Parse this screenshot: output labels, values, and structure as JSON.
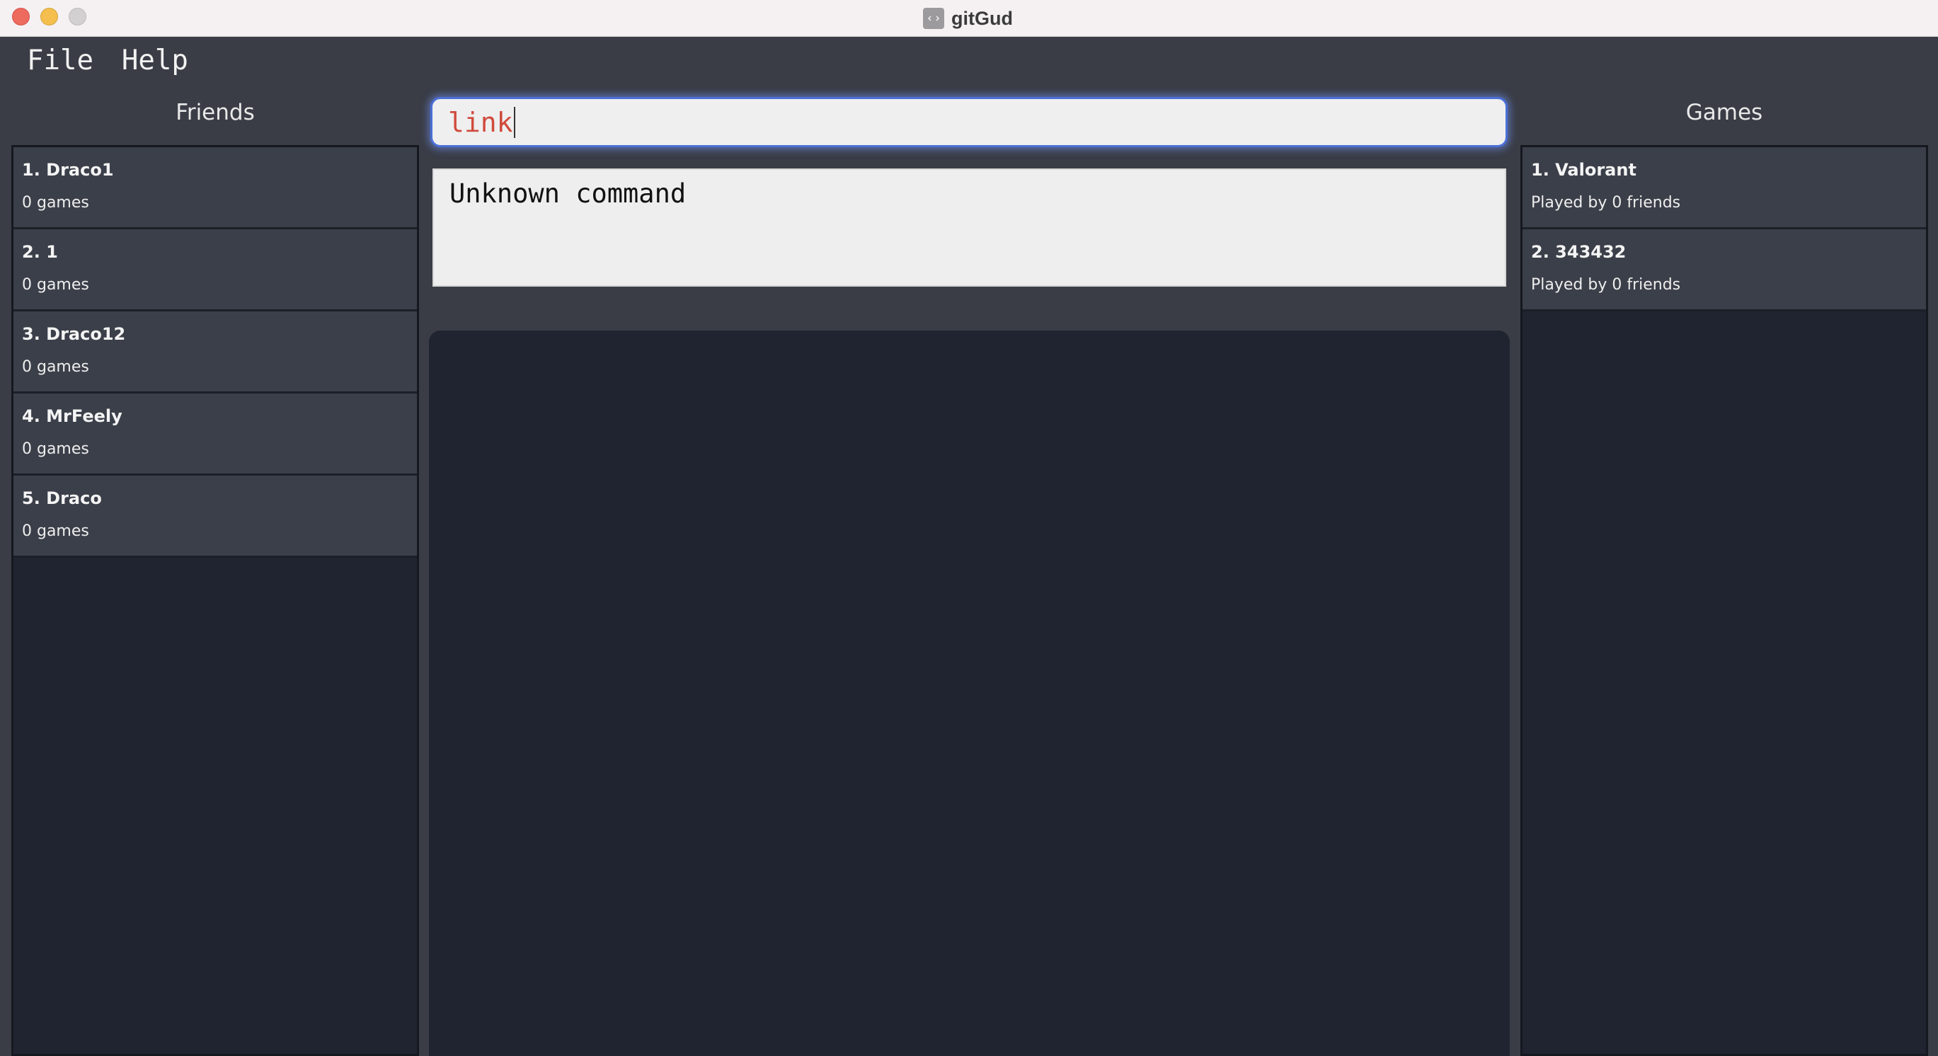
{
  "window": {
    "title": "gitGud"
  },
  "menu": {
    "file": "File",
    "help": "Help"
  },
  "friends": {
    "heading": "Friends",
    "items": [
      {
        "name": "1. Draco1",
        "sub": "0 games"
      },
      {
        "name": "2. 1",
        "sub": "0 games"
      },
      {
        "name": "3. Draco12",
        "sub": "0 games"
      },
      {
        "name": "4. MrFeely",
        "sub": "0 games"
      },
      {
        "name": "5. Draco",
        "sub": "0 games"
      }
    ]
  },
  "command": {
    "value": "link"
  },
  "result": {
    "text": "Unknown command"
  },
  "games": {
    "heading": "Games",
    "items": [
      {
        "name": "1. Valorant",
        "sub": "Played by 0 friends"
      },
      {
        "name": "2. 343432",
        "sub": "Played by 0 friends"
      }
    ]
  },
  "colors": {
    "background": "#3a3d46",
    "panel": "#1f2430",
    "list_item": "#3b3f49",
    "command_text": "#d04a3c",
    "focus_ring": "#4b6fd6"
  },
  "icons": {
    "close": "close-icon",
    "minimize": "minimize-icon",
    "zoom": "zoom-icon",
    "app": "app-icon"
  }
}
